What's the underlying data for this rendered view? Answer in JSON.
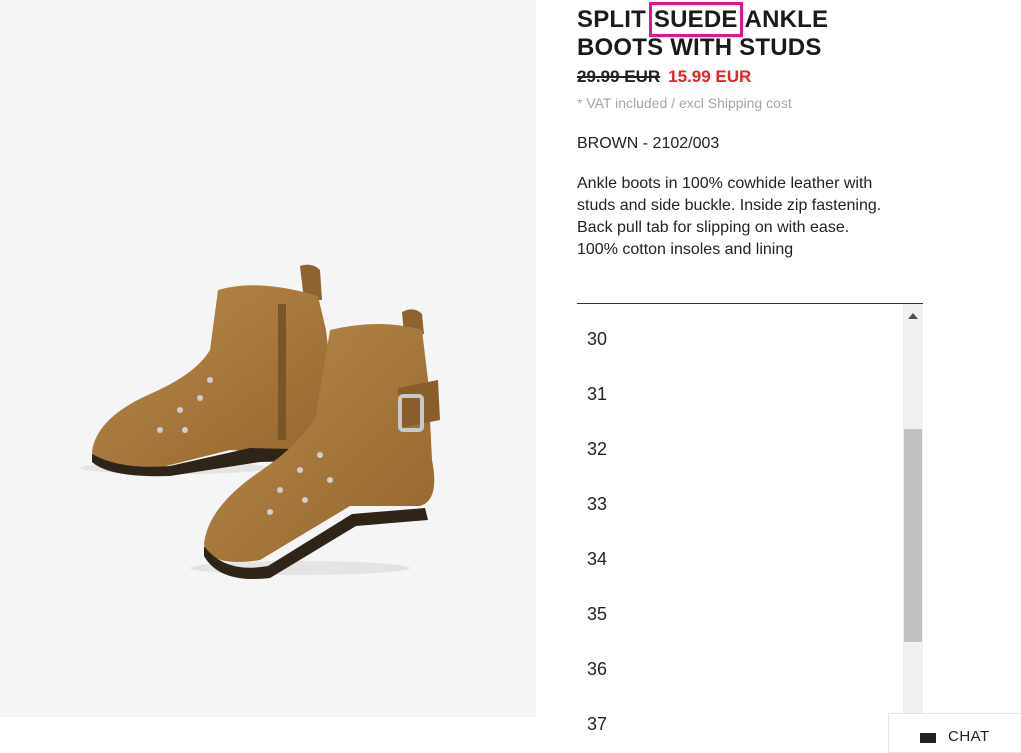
{
  "product": {
    "title_part1": "SPLIT ",
    "title_highlight": "SUEDE",
    "title_part2": " ANKLE BOOTS WITH STUDS",
    "old_price": "29.99 EUR",
    "new_price": "15.99 EUR",
    "vat_note": "* VAT included / excl Shipping cost",
    "color_ref": "BROWN - 2102/003",
    "description_lines": [
      "Ankle boots in 100% cowhide leather with",
      "studs and side buckle. Inside zip fastening.",
      "Back pull tab for slipping on with ease.",
      "100% cotton insoles and lining"
    ]
  },
  "sizes": [
    "30",
    "31",
    "32",
    "33",
    "34",
    "35",
    "36",
    "37"
  ],
  "chat": {
    "label": "CHAT"
  },
  "colors": {
    "sale_price": "#e8231f",
    "highlight_box": "#e0158f",
    "boot": "#a97b3d"
  }
}
